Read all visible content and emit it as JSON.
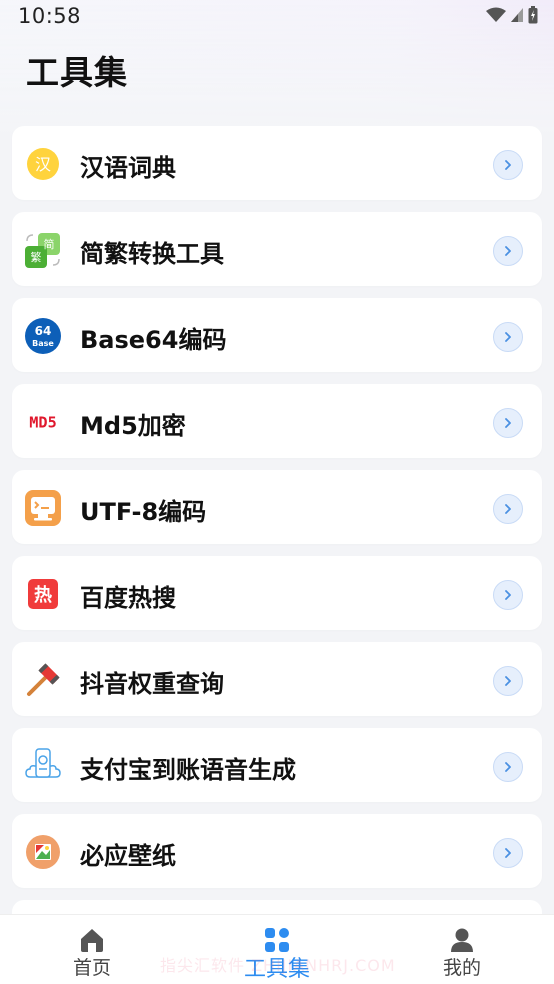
{
  "status_bar": {
    "time": "10:58"
  },
  "header": {
    "title": "工具集"
  },
  "tools": [
    {
      "label": "汉语词典",
      "icon": "hanyu-dictionary-icon",
      "icon_text": "汉"
    },
    {
      "label": "简繁转换工具",
      "icon": "simplified-traditional-icon",
      "icon_text_1": "简",
      "icon_text_2": "繁"
    },
    {
      "label": "Base64编码",
      "icon": "base64-icon",
      "icon_text_1": "64",
      "icon_text_2": "Base"
    },
    {
      "label": "Md5加密",
      "icon": "md5-icon",
      "icon_text": "MD5"
    },
    {
      "label": "UTF-8编码",
      "icon": "utf8-icon"
    },
    {
      "label": "百度热搜",
      "icon": "baidu-hot-icon",
      "icon_text": "热"
    },
    {
      "label": "抖音权重查询",
      "icon": "hammer-icon"
    },
    {
      "label": "支付宝到账语音生成",
      "icon": "alipay-voice-icon"
    },
    {
      "label": "必应壁纸",
      "icon": "bing-wallpaper-icon"
    }
  ],
  "bottom_nav": {
    "items": [
      {
        "label": "首页",
        "icon": "home-icon"
      },
      {
        "label": "工具集",
        "icon": "grid-icon",
        "active": true
      },
      {
        "label": "我的",
        "icon": "user-icon"
      }
    ]
  },
  "watermark": "指尖汇软件 ZHIJIANHRJ.COM",
  "colors": {
    "accent": "#2d8cf0",
    "chevron_bg": "#e6effc",
    "card_bg": "#ffffff",
    "page_bg": "#f3f4f7"
  }
}
